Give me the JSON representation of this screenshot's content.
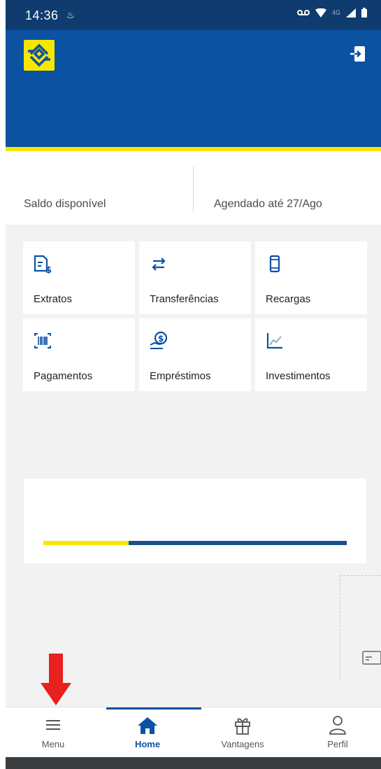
{
  "statusbar": {
    "time": "14:36",
    "notif_icon": "app-notification",
    "network": "4G"
  },
  "header": {
    "logo_icon": "bank-logo",
    "logout_icon": "logout-icon",
    "colors": {
      "blue": "#0b52a3",
      "yellow": "#f7e600"
    }
  },
  "balance": {
    "left_label": "Saldo disponível",
    "right_label": "Agendado até 27/Ago"
  },
  "tiles": [
    {
      "label": "Extratos",
      "icon": "statement-icon"
    },
    {
      "label": "Transferências",
      "icon": "transfer-icon"
    },
    {
      "label": "Recargas",
      "icon": "phone-icon"
    },
    {
      "label": "Pagamentos",
      "icon": "barcode-icon"
    },
    {
      "label": "Empréstimos",
      "icon": "loan-icon"
    },
    {
      "label": "Investimentos",
      "icon": "chart-icon"
    }
  ],
  "nav": {
    "menu": "Menu",
    "home": "Home",
    "vantagens": "Vantagens",
    "perfil": "Perfil"
  }
}
